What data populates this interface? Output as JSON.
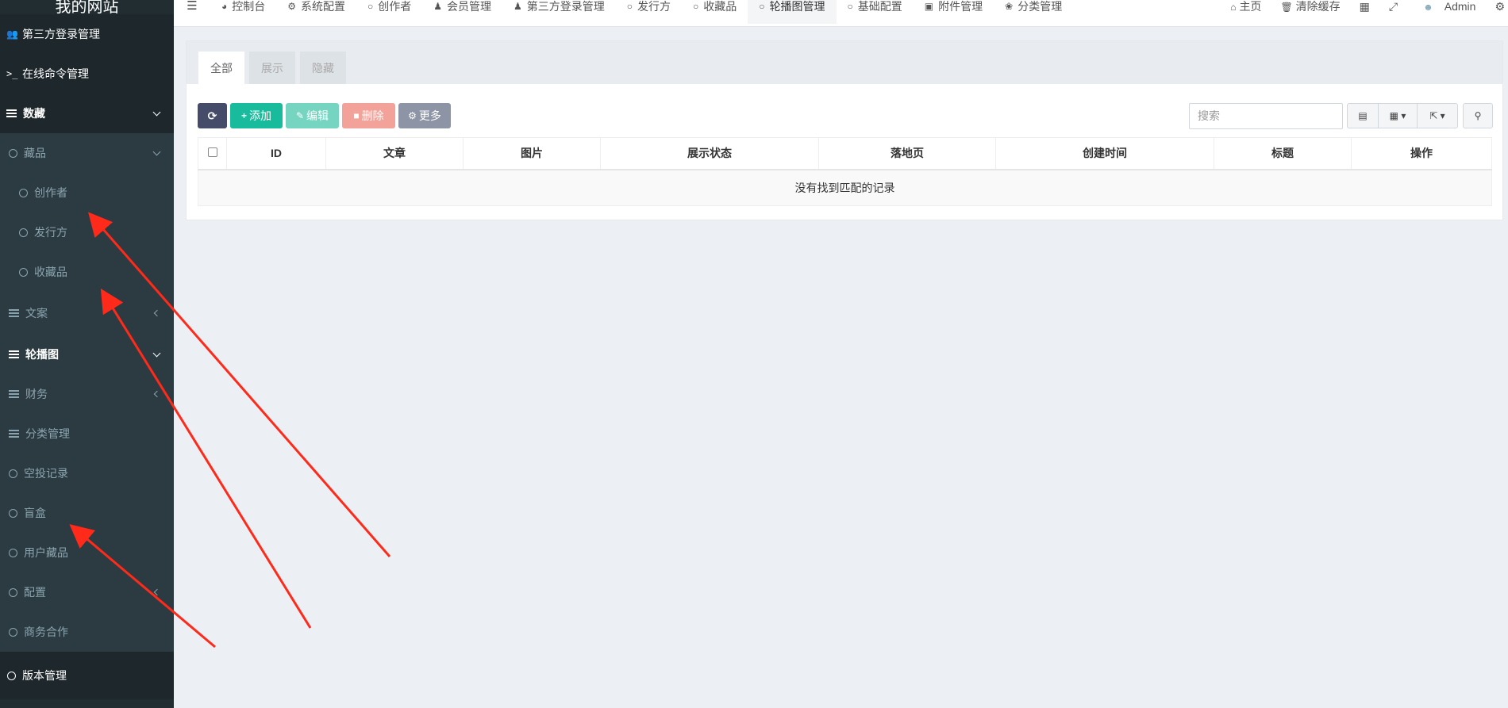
{
  "sidebar": {
    "logo": "我的网站",
    "items": [
      {
        "label": "第三方登录管理",
        "icon": "users-icon"
      },
      {
        "label": "在线命令管理",
        "icon": "terminal-icon"
      },
      {
        "label": "数藏",
        "icon": "list-icon"
      },
      {
        "label": "藏品",
        "icon": "circle-icon"
      },
      {
        "label": "创作者",
        "icon": "circle-icon"
      },
      {
        "label": "发行方",
        "icon": "circle-icon"
      },
      {
        "label": "收藏品",
        "icon": "circle-icon"
      },
      {
        "label": "文案",
        "icon": "list-icon"
      },
      {
        "label": "轮播图",
        "icon": "list-icon"
      },
      {
        "label": "财务",
        "icon": "list-icon"
      },
      {
        "label": "分类管理",
        "icon": "list-icon"
      },
      {
        "label": "空投记录",
        "icon": "circle-icon"
      },
      {
        "label": "盲盒",
        "icon": "circle-icon"
      },
      {
        "label": "用户藏品",
        "icon": "circle-icon"
      },
      {
        "label": "配置",
        "icon": "circle-icon"
      },
      {
        "label": "商务合作",
        "icon": "circle-icon"
      },
      {
        "label": "版本管理",
        "icon": "circle-icon"
      }
    ]
  },
  "topnav": {
    "tabs": [
      {
        "label": "控制台",
        "icon": "dashboard-icon"
      },
      {
        "label": "系统配置",
        "icon": "gear-icon"
      },
      {
        "label": "创作者",
        "icon": "circle-icon"
      },
      {
        "label": "会员管理",
        "icon": "user-icon"
      },
      {
        "label": "第三方登录管理",
        "icon": "users-icon"
      },
      {
        "label": "发行方",
        "icon": "circle-icon"
      },
      {
        "label": "收藏品",
        "icon": "circle-icon"
      },
      {
        "label": "轮播图管理",
        "icon": "circle-icon",
        "active": true
      },
      {
        "label": "基础配置",
        "icon": "circle-icon"
      },
      {
        "label": "附件管理",
        "icon": "image-icon"
      },
      {
        "label": "分类管理",
        "icon": "leaf-icon"
      }
    ],
    "right": {
      "home": "主页",
      "clear_cache": "清除缓存",
      "user": "Admin"
    }
  },
  "panel": {
    "tabs": [
      "全部",
      "展示",
      "隐藏"
    ],
    "buttons": {
      "add": "添加",
      "edit": "编辑",
      "delete": "删除",
      "more": "更多"
    },
    "search_placeholder": "搜索",
    "table": {
      "headers": [
        "ID",
        "文章",
        "图片",
        "展示状态",
        "落地页",
        "创建时间",
        "标题",
        "操作"
      ],
      "empty": "没有找到匹配的记录"
    }
  },
  "colors": {
    "sidebar_bg": "#222d32",
    "accent_green": "#18bc9c",
    "danger_light": "#f3a29a",
    "arrow_red": "#ff2a1a"
  }
}
